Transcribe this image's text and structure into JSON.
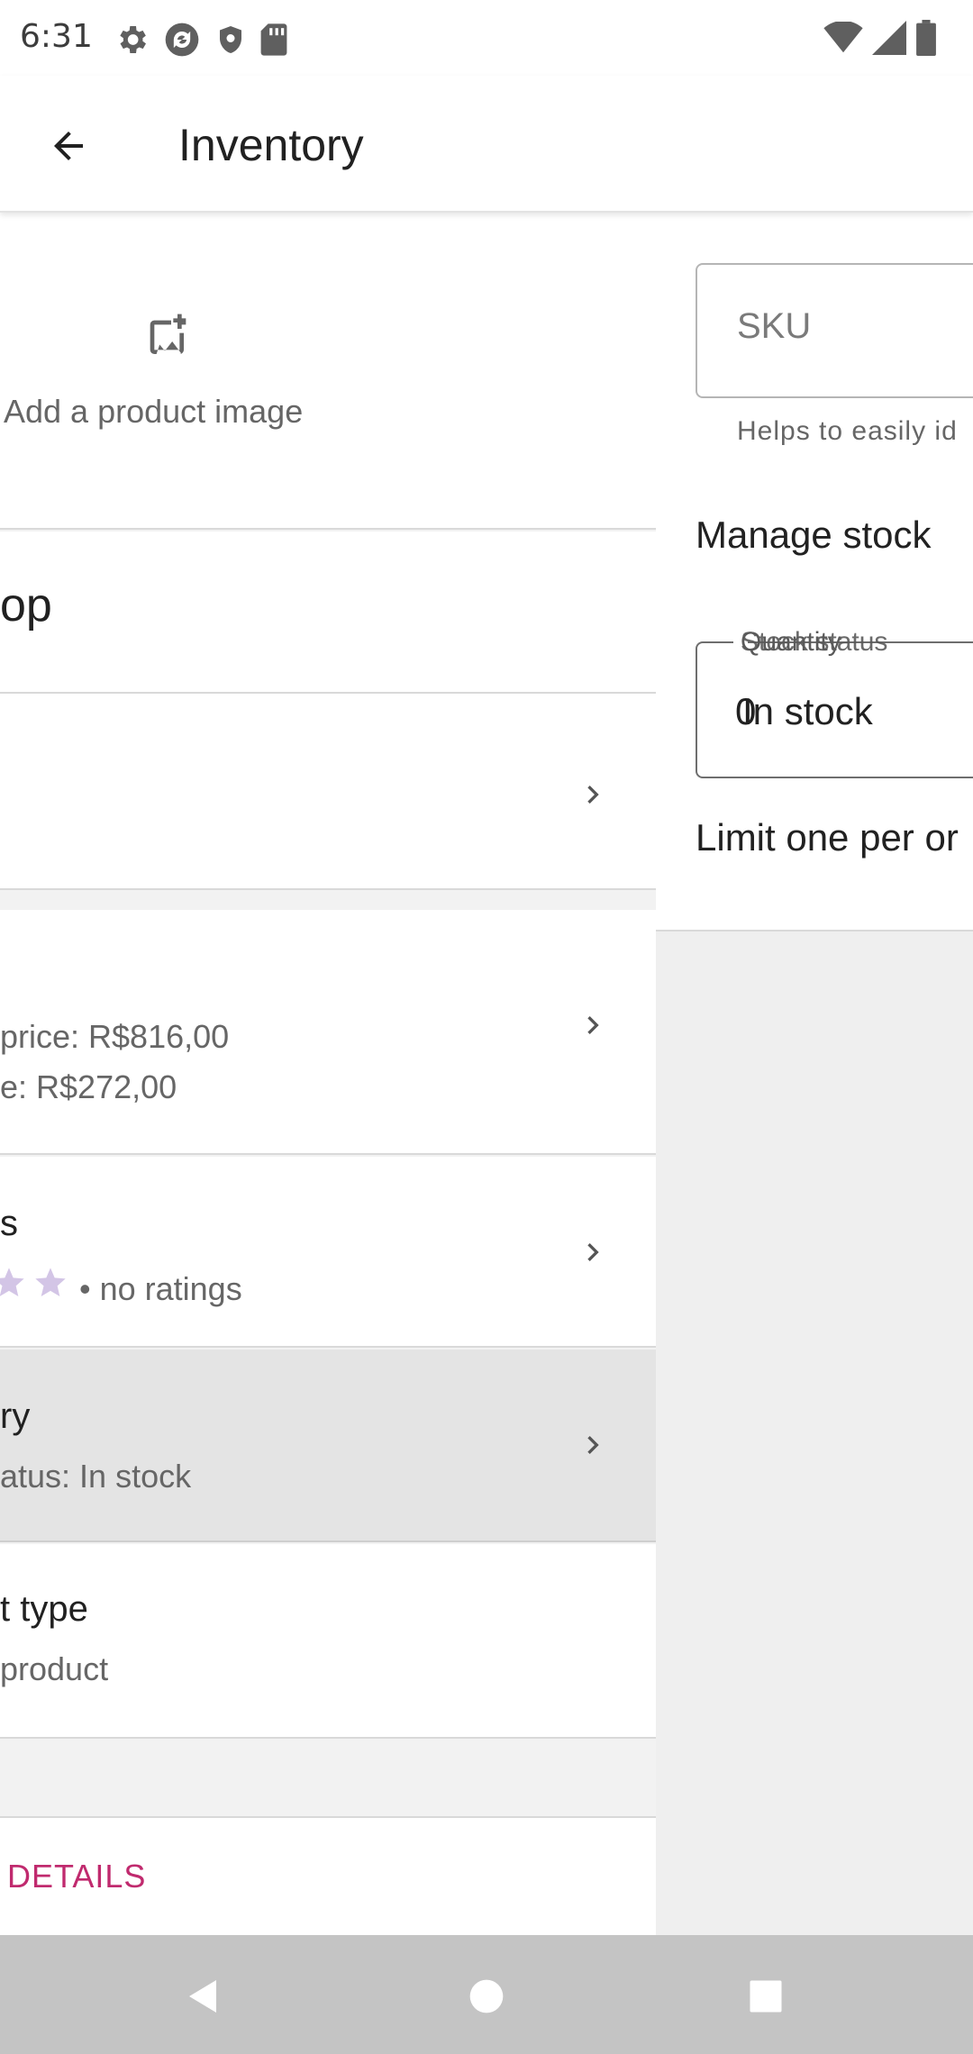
{
  "status_bar": {
    "time": "6:31",
    "left_icons": [
      "gear-icon",
      "sync-icon",
      "shield-icon",
      "sd-card-icon"
    ],
    "right_icons": [
      "wifi-icon",
      "signal-icon",
      "battery-icon"
    ]
  },
  "app_bar": {
    "back_icon": "arrow-back-icon",
    "title": "Inventory"
  },
  "product_detail": {
    "add_image_label": "Add a product image",
    "name_partial": "op",
    "price_lines": [
      "price: R$816,00",
      "e: R$272,00"
    ],
    "reviews": {
      "title_partial": "s",
      "ratings_text": "• no ratings",
      "star_color": "#d3c5e6"
    },
    "inventory": {
      "title_partial": "ry",
      "status_partial": "atus: In stock"
    },
    "product_type": {
      "title_partial": "t type",
      "value_partial": " product"
    },
    "details_button": "DETAILS"
  },
  "inventory_panel": {
    "sku_placeholder": "SKU",
    "sku_helper": "Helps to easily id",
    "manage_stock_label": "Manage stock",
    "stock_field_label_a": "Quantity",
    "stock_field_label_b": "Stock status",
    "stock_field_value_a": "0",
    "stock_field_value_b": "In stock",
    "limit_one_label": "Limit one per or"
  },
  "nav_bar": {
    "buttons": [
      "back-triangle-icon",
      "home-circle-icon",
      "recents-square-icon"
    ]
  },
  "colors": {
    "accent": "#c02a6e",
    "nav_bar": "#c4c4c4",
    "highlight_row": "#e4e4e4"
  }
}
